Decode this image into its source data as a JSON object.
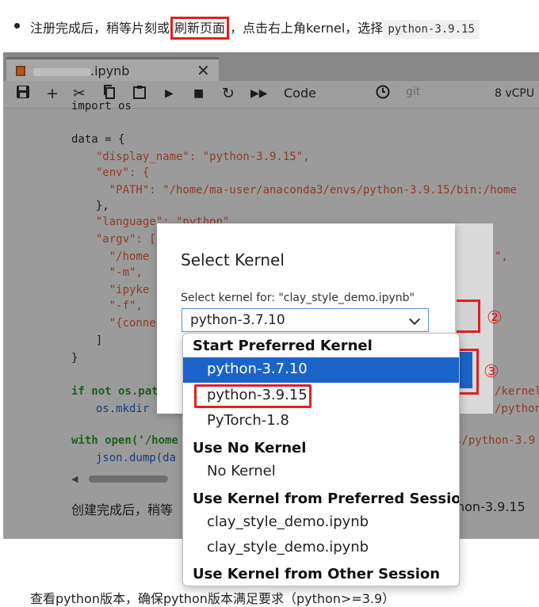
{
  "doc": {
    "step_text_1": "注册完成后，稍等片刻或",
    "step_highlight": "刷新页面",
    "step_text_2": "，点击右上角kernel，选择",
    "step_code": "python-3.9.15",
    "bottom_text": "查看python版本，确保python版本满足要求（python>=3.9）"
  },
  "notebook": {
    "tab_title": ".ipynb",
    "toolbar": {
      "cell_type": "Code",
      "git_label": "git",
      "resource": "8 vCPU"
    },
    "code_lines": [
      "import os",
      "data = {",
      "  \"display_name\": \"python-3.9.15\",",
      "  \"env\": {",
      "    \"PATH\": \"/home/ma-user/anaconda3/envs/python-3.9.15/bin:/home",
      "  },",
      "  \"language\": \"python\",",
      "  \"argv\": [",
      "    \"/home",
      "    \"-m\",",
      "    \"ipyke",
      "    \"-f\",",
      "    \"{conne",
      "  ]",
      "}",
      "if not os.pat",
      "  os.mkdir",
      "with open('/home",
      "  json.dump(da"
    ],
    "code_right_fragments": [
      "\",",
      "/kernel",
      "/python-",
      "s/python-3.9"
    ],
    "caption_left": "创建完成后，稍等",
    "caption_right": "hon-3.9.15"
  },
  "dialog": {
    "title": "Select Kernel",
    "label": "Select kernel for: \"clay_style_demo.ipynb\"",
    "selected_value": "python-3.7.10",
    "annotation_2": "②",
    "annotation_3": "③"
  },
  "dropdown": {
    "groups": [
      {
        "label": "Start Preferred Kernel",
        "options": [
          "python-3.7.10",
          "python-3.9.15",
          "PyTorch-1.8"
        ]
      },
      {
        "label": "Use No Kernel",
        "options": [
          "No Kernel"
        ]
      },
      {
        "label": "Use Kernel from Preferred Session",
        "options": [
          "clay_style_demo.ipynb",
          "clay_style_demo.ipynb"
        ]
      },
      {
        "label": "Use Kernel from Other Session",
        "options": []
      }
    ],
    "highlighted_option": "python-3.7.10",
    "annotated_option": "python-3.9.15"
  },
  "colors": {
    "accent_blue": "#1a64c8",
    "annotation_red": "#e02020",
    "overlay_gray": "#9b9b9b"
  }
}
